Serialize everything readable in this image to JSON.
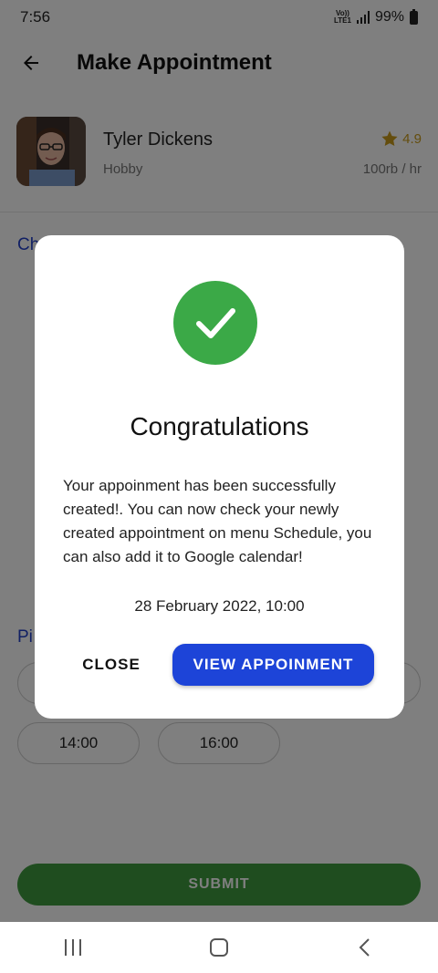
{
  "status_bar": {
    "time": "7:56",
    "volte_line1": "Vo))",
    "volte_line2": "LTE1",
    "battery": "99%"
  },
  "app_bar": {
    "title": "Make Appointment",
    "back_icon": "arrow-left-icon"
  },
  "tutor": {
    "name": "Tyler Dickens",
    "category": "Hobby",
    "rating": "4.9",
    "price": "100rb / hr"
  },
  "sections": {
    "choose_label": "Ch",
    "pick_label": "Pi"
  },
  "time_slots": [
    "14:00",
    "16:00"
  ],
  "submit": {
    "label": "SUBMIT"
  },
  "dialog": {
    "title": "Congratulations",
    "body": "Your appoinment has been successfully created!. You can now check your newly created appointment on menu Schedule, you can also add it to Google calendar!",
    "date": "28 February 2022, 10:00",
    "close_label": "CLOSE",
    "view_label": "VIEW APPOINMENT"
  },
  "colors": {
    "accent_blue": "#1d44d8",
    "success_green": "#3ba947",
    "rating_gold": "#c89a1a",
    "submit_green": "#3f9a3f"
  }
}
